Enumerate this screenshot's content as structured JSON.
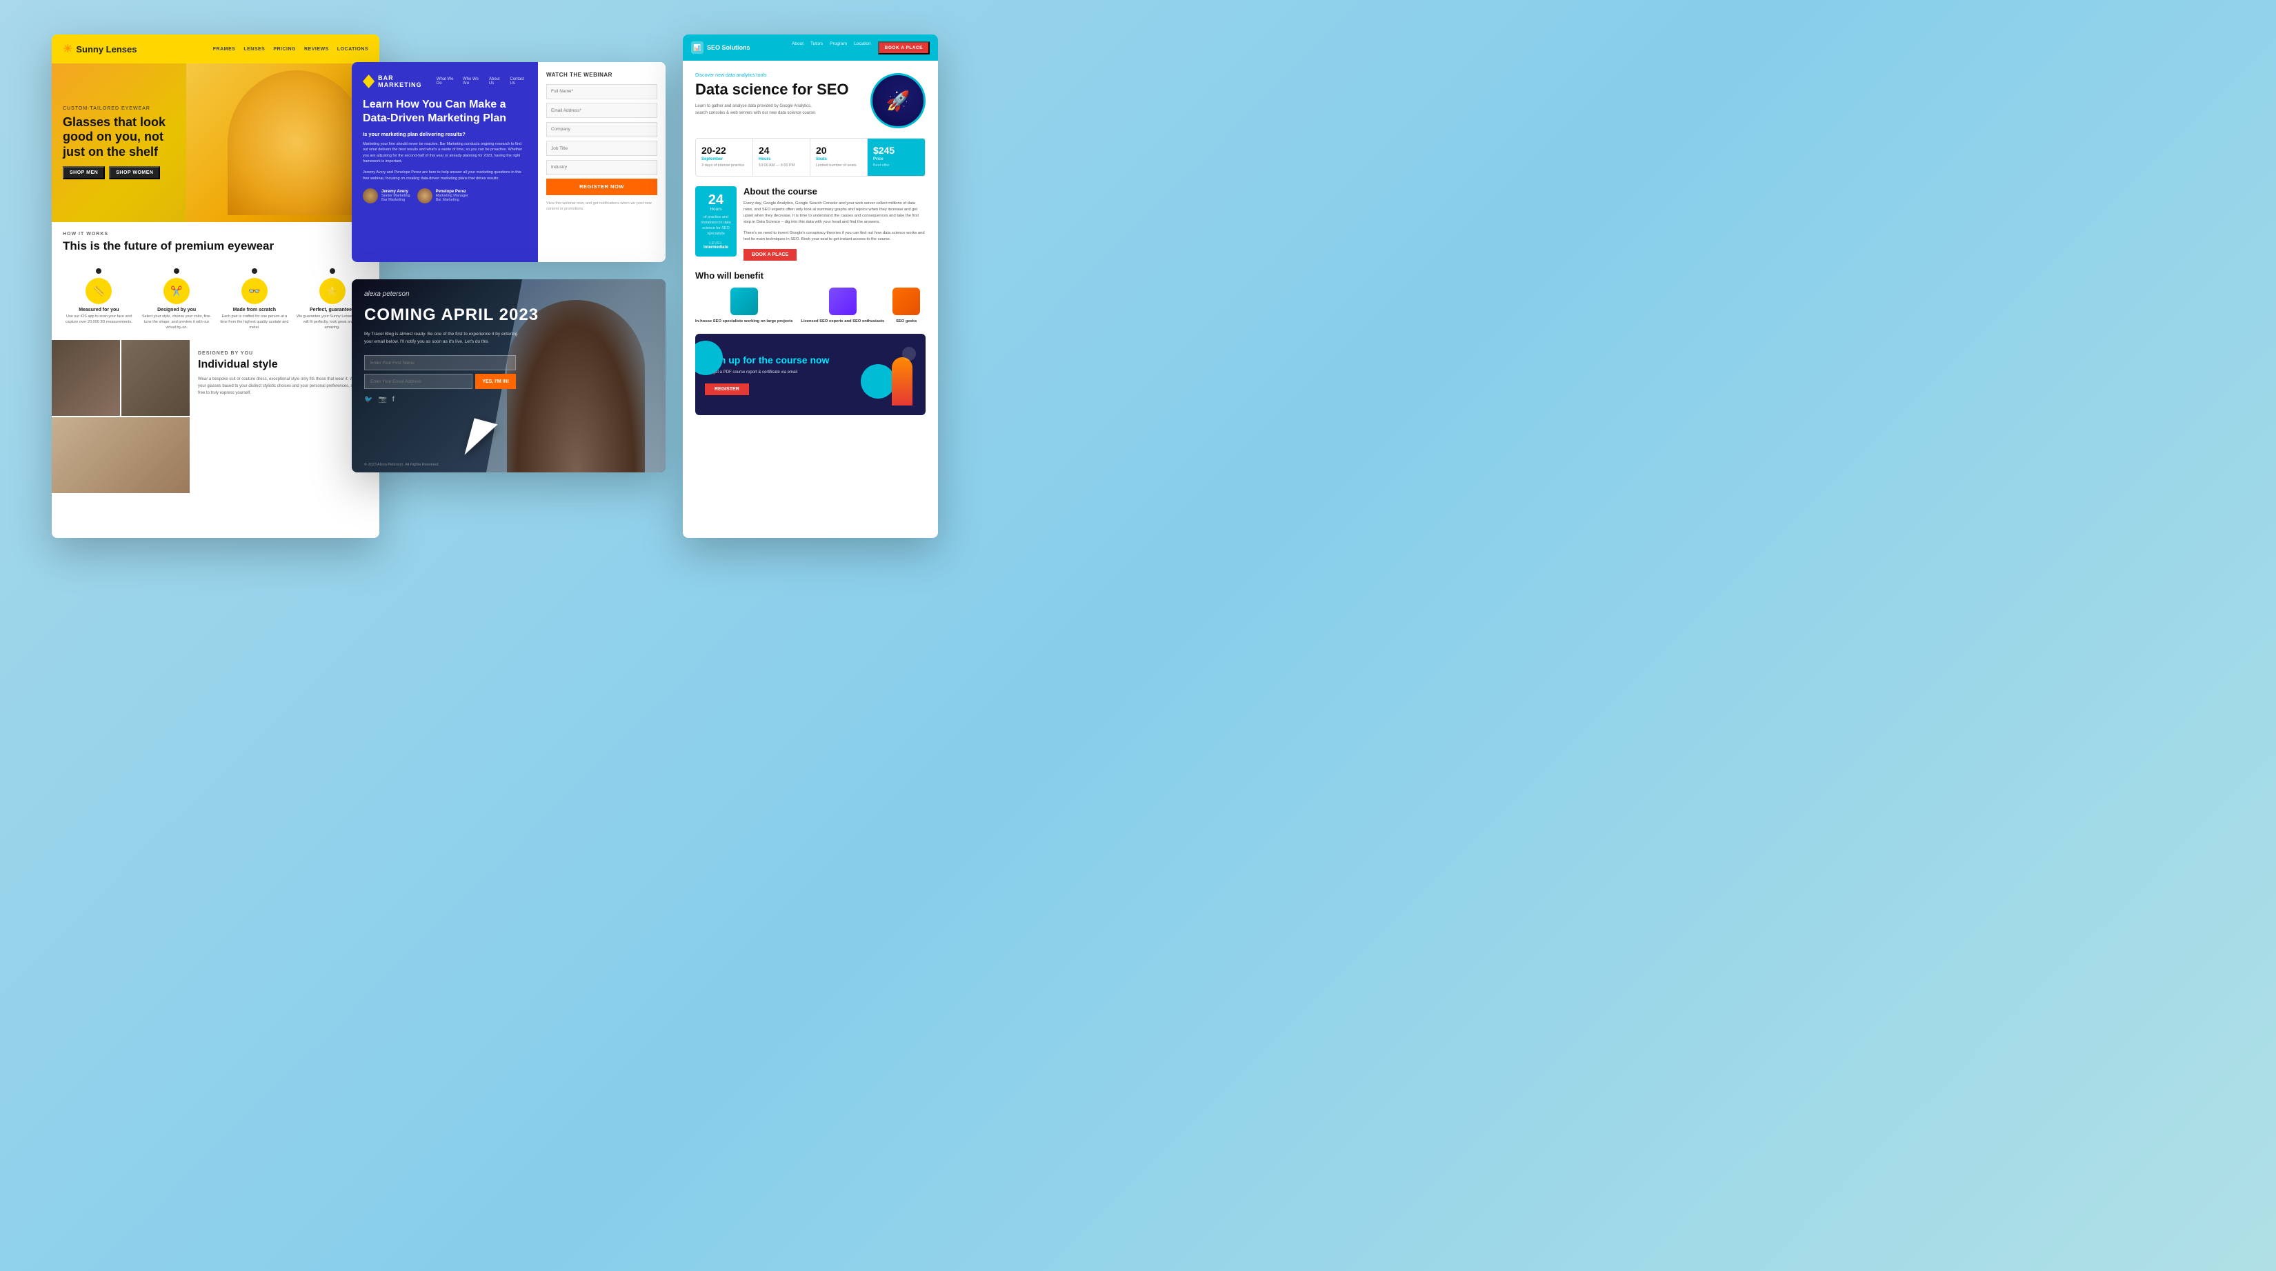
{
  "card1": {
    "header": {
      "logo": "Sunny Lenses",
      "nav": [
        "FRAMES",
        "LENSES",
        "PRICING",
        "REVIEWS",
        "LOCATIONS"
      ]
    },
    "hero": {
      "eyewear_label": "CUSTOM-TAILORED EYEWEAR",
      "title": "Glasses that look good on you, not just on the shelf",
      "btn_men": "SHOP MEN",
      "btn_women": "SHOP WOMEN"
    },
    "how": {
      "label": "HOW IT WORKS",
      "title": "This is the future of premium eyewear"
    },
    "features": [
      {
        "name": "Measured for you",
        "desc": "Use our iOS app to scan your face and capture over 20,000 3D measurements.",
        "icon": "📏"
      },
      {
        "name": "Designed by you",
        "desc": "Select your style, choose your color, fine-tune the shape, and preview it with our virtual try-on.",
        "icon": "✂️"
      },
      {
        "name": "Made from scratch",
        "desc": "Each pair is crafted for one person at a time from the highest quality acetate and metal.",
        "icon": "👓"
      },
      {
        "name": "Perfect, guaranteed",
        "desc": "We guarantee your Sunny Lenses glasses will fit perfectly, look great and feel amazing.",
        "icon": "⭐"
      }
    ],
    "individual": {
      "label": "DESIGNED BY YOU",
      "title": "Individual style",
      "desc": "Wear a bespoke suit or couture dress, exceptional style only fits those that wear it. We craft your glasses based to your distinct stylistic choices and your personal preferences, so yours free to truly express yourself."
    }
  },
  "card2": {
    "brand": "BAR MARKETING",
    "nav": [
      "What We Do",
      "Who We Are",
      "About Us",
      "Contact Us"
    ],
    "learn_title": "Learn How You Can Make a Data-Driven Marketing Plan",
    "subtitle": "Is your marketing plan delivering results?",
    "desc": "Marketing your firm should never be reactive. Bar Marketing conducts ongoing research to find out what delivers the best results and what's a waste of time, so you can be proactive. Whether you are adjusting for the second-half of this year or already planning for 2023, having the right framework is important.\n\nJeremy Avery and Penelope Perez are here to help answer all your marketing questions in this free webinar, focusing on creating data-driven marketing plans that drives results.",
    "watch_label": "WATCH THE WEBINAR",
    "fields": [
      "Full Name*",
      "Email Address*",
      "Company",
      "Job Title",
      "Industry"
    ],
    "register_btn": "REGISTER NOW",
    "footnote": "View this webinar now, and get notifications when we post new content or promotions.",
    "speakers": [
      {
        "name": "Jeremy Avery",
        "role": "Senior Marketing\nBar Marketing"
      },
      {
        "name": "Penelope Perez",
        "role": "Marketing Manager\nBar Marketing"
      }
    ]
  },
  "card3": {
    "author": "alexa peterson",
    "title": "COMING APRIL 2023",
    "desc": "My Travel Blog is almost ready. Be one of the first to experience it by entering your email below. I'll notify you as soon as it's live. Let's do this",
    "name_placeholder": "Enter Your First Name",
    "email_placeholder": "Enter Your Email Address",
    "submit_btn": "YES, I'M IN!",
    "social": [
      "twitter",
      "instagram",
      "facebook"
    ],
    "footer": "© 2023 Alexa Peterson. All Rights Reserved."
  },
  "card4": {
    "header": {
      "logo": "SEO Solutions",
      "nav": [
        "About",
        "Tutors",
        "Program",
        "Location"
      ],
      "book_btn": "BOOK A PLACE"
    },
    "hero": {
      "discover": "Discover new data analytics tools",
      "title": "Data science for SEO",
      "desc": "Learn to gather and analyse data provided by Google Analytics, search consoles & web servers with our new data science course."
    },
    "stats": [
      {
        "number": "20-22",
        "label": "September",
        "sub": "3 days of intense practice"
      },
      {
        "number": "24",
        "label": "Hours",
        "sub": "10:00 AM — 6:00 PM"
      },
      {
        "number": "20",
        "label": "Seats",
        "sub": "Limited number of seats"
      },
      {
        "number": "$245",
        "label": "Price",
        "sub": "Best offer"
      }
    ],
    "about": {
      "hours_num": "24",
      "hours_label": "Hours",
      "hours_sub": "of practice and immersion in data science for SEO specialists",
      "level_label": "Level",
      "level_value": "Intermediate",
      "title": "About the course",
      "text1": "Every day, Google Analytics, Google Search Console and your web server collect millions of data rows, and SEO experts often only look at summary graphs and rejoice when they increase and get upset when they decrease. It is time to understand the causes and consequences and take the first step in Data Science – dig into this data with your head and find the answers.",
      "text2": "There's no need to invent Google's conspiracy theories if you can find out how data science works and test its main techniques in SEO. Book your seat to get instant access to the course.",
      "book_btn": "BOOK A PLACE"
    },
    "who": {
      "title": "Who will benefit",
      "items": [
        {
          "label": "In-house SEO specialists working on large projects"
        },
        {
          "label": "Licensed SEO experts and SEO enthusiasts"
        },
        {
          "label": "SEO geeks"
        }
      ]
    },
    "signup": {
      "title": "Sign up for the course now",
      "sub": "and get a PDF course report & certificate via email",
      "register_btn": "REGISTER"
    }
  }
}
